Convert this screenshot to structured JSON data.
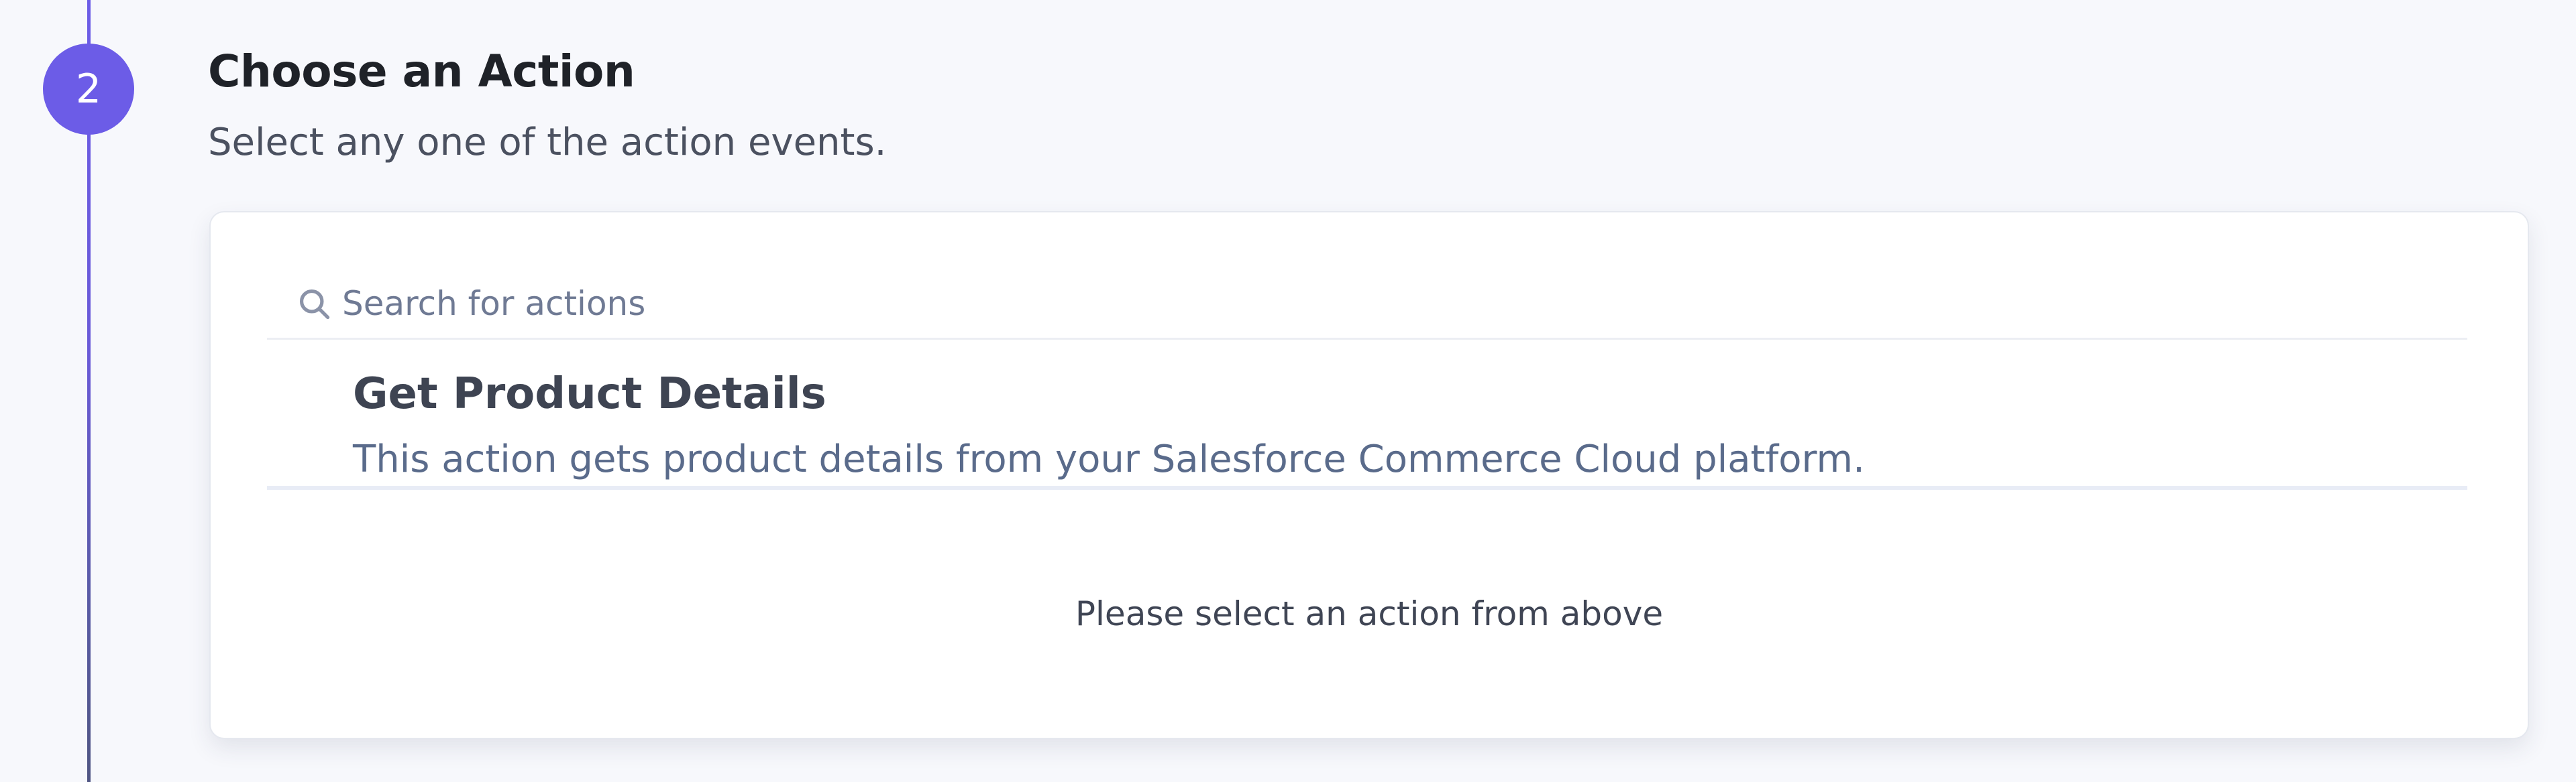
{
  "step": {
    "number": "2",
    "title": "Choose an Action",
    "subtitle": "Select any one of the action events."
  },
  "search": {
    "placeholder": "Search for actions",
    "value": "",
    "icon": "search-icon"
  },
  "actions": [
    {
      "title": "Get Product Details",
      "description": "This action gets product details from your Salesforce Commerce Cloud platform."
    }
  ],
  "empty_message": "Please select an action from above",
  "colors": {
    "accent": "#6c5ce7",
    "background": "#f7f8fc",
    "card": "#ffffff",
    "muted_text": "#5a6b8b"
  }
}
